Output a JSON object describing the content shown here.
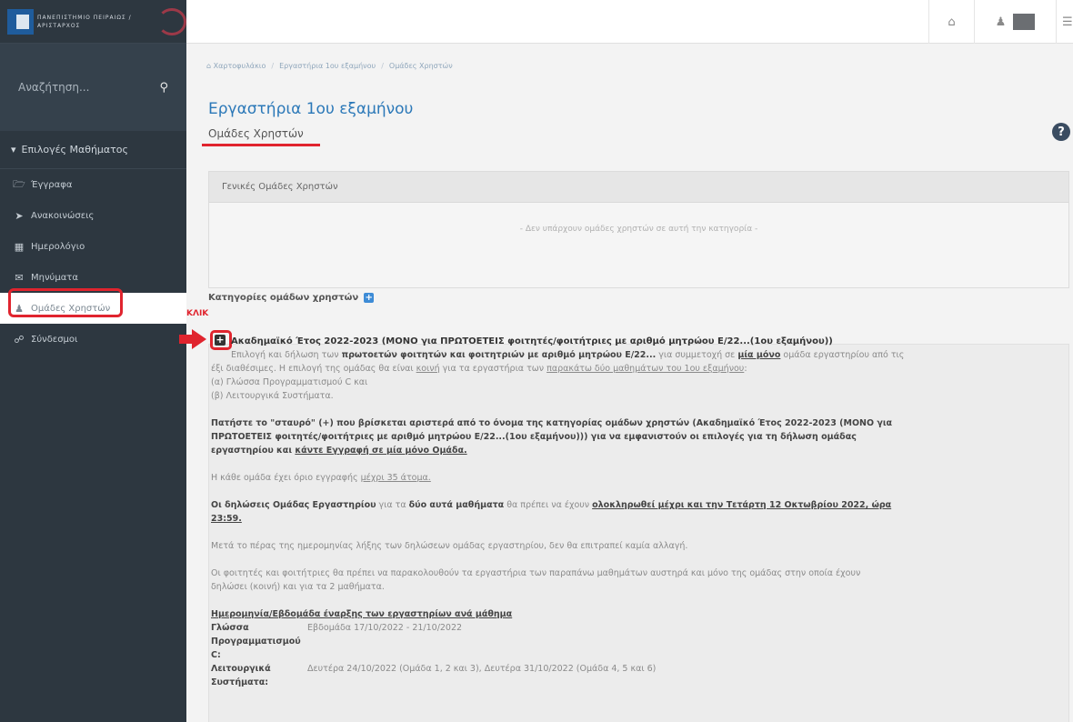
{
  "sidebar": {
    "logo_text": "ΠΑΝΕΠΙΣΤΗΜΙΟ ΠΕΙΡΑΙΩΣ / ΑΡΙΣΤΑΡΧΟΣ",
    "search_placeholder": "Αναζήτηση...",
    "section": "Επιλογές Μαθήματος",
    "items": [
      {
        "label": "Έγγραφα",
        "icon": "folder-icon"
      },
      {
        "label": "Ανακοινώσεις",
        "icon": "megaphone-icon"
      },
      {
        "label": "Ημερολόγιο",
        "icon": "calendar-icon"
      },
      {
        "label": "Μηνύματα",
        "icon": "envelope-icon"
      },
      {
        "label": "Ομάδες Χρηστών",
        "icon": "users-icon",
        "active": true
      },
      {
        "label": "Σύνδεσμοι",
        "icon": "link-icon"
      }
    ]
  },
  "topbar": {
    "home_icon": "home-icon",
    "user_icon": "user-icon",
    "menu_icon": "menu-icon"
  },
  "breadcrumb": [
    "Χαρτοφυλάκιο",
    "Εργαστήρια 1ου εξαμήνου",
    "Ομάδες Χρηστών"
  ],
  "page": {
    "title": "Εργαστήρια 1ου εξαμήνου",
    "subtitle": "Ομάδες Χρηστών",
    "help": "?"
  },
  "general_panel": {
    "heading": "Γενικές Ομάδες Χρηστών",
    "empty": "- Δεν υπάρχουν ομάδες χρηστών σε αυτή την κατηγορία -"
  },
  "categories": {
    "heading": "Κατηγορίες ομάδων χρηστών",
    "add_icon": "+",
    "annotation": "ΚΛΙΚ",
    "toggle": "+",
    "title": "Ακαδημαϊκό Έτος 2022-2023 (ΜΟΝΟ για ΠΡΩΤΟΕΤΕΙΣ φοιτητές/φοιτήτριες με αριθμό μητρώου Ε/22...(1ου εξαμήνου))",
    "p1a": "Επιλογή και δήλωση των ",
    "p1b": "πρωτοετών φοιτητών και φοιτητριών με αριθμό μητρώου Ε/22...",
    "p1c": " για συμμετοχή σε ",
    "p1d": "μία μόνο",
    "p1e": " ομάδα εργαστηρίου από τις",
    "p1f": "έξι διαθέσιμες. Η επιλογή της ομάδας θα είναι ",
    "p1g": "κοινή",
    "p1h": " για τα εργαστήρια των ",
    "p1i": "παρακάτω δύο μαθημάτων του 1ου εξαμήνου",
    "p1j": ":",
    "p1k": "(α) Γλώσσα Προγραμματισμού C και",
    "p1l": "(β) Λειτουργικά Συστήματα.",
    "p2": "Πατήστε το \"σταυρό\" (+) που βρίσκεται αριστερά από το όνομα της κατηγορίας ομάδων χρηστών (Ακαδημαϊκό Έτος 2022-2023 (ΜΟΝΟ για",
    "p2b": "ΠΡΩΤΟΕΤΕΙΣ φοιτητές/φοιτήτριες με αριθμό μητρώου Ε/22...(1ου εξαμήνου))) για να εμφανιστούν οι επιλογές για τη δήλωση ομάδας",
    "p2c": "εργαστηρίου και ",
    "p2d": "κάντε Εγγραφή σε μία μόνο Ομάδα.",
    "p3a": "Η κάθε ομάδα έχει όριο εγγραφής ",
    "p3b": "μέχρι 35 άτομα.",
    "p4a": "Οι δηλώσεις Ομάδας Εργαστηρίου",
    "p4b": " για τα ",
    "p4c": "δύο αυτά μαθήματα",
    "p4d": " θα πρέπει να έχουν ",
    "p4e": "ολοκληρωθεί μέχρι και την Τετάρτη 12 Οκτωβρίου 2022, ώρα",
    "p4f": "23:59.",
    "p5": "Μετά το πέρας της ημερομηνίας λήξης των δηλώσεων ομάδας εργαστηρίου, δεν θα επιτραπεί καμία αλλαγή.",
    "p6": "Οι φοιτητές και φοιτήτριες θα πρέπει να παρακολουθούν τα εργαστήρια των παραπάνω μαθημάτων αυστηρά και μόνο της ομάδας στην οποία έχουν",
    "p6b": "δηλώσει (κοινή) και για τα 2 μαθήματα.",
    "sched_heading": "Ημερομηνία/Εβδομάδα έναρξης των εργαστηρίων ανά μάθημα",
    "sched": [
      {
        "label": "Γλώσσα Προγραμματισμού C:",
        "value": "Εβδομάδα 17/10/2022 - 21/10/2022"
      },
      {
        "label": "Λειτουργικά Συστήματα:",
        "value": "Δευτέρα 24/10/2022 (Ομάδα 1, 2 και 3), Δευτέρα 31/10/2022 (Ομάδα 4, 5 και 6)"
      }
    ]
  }
}
